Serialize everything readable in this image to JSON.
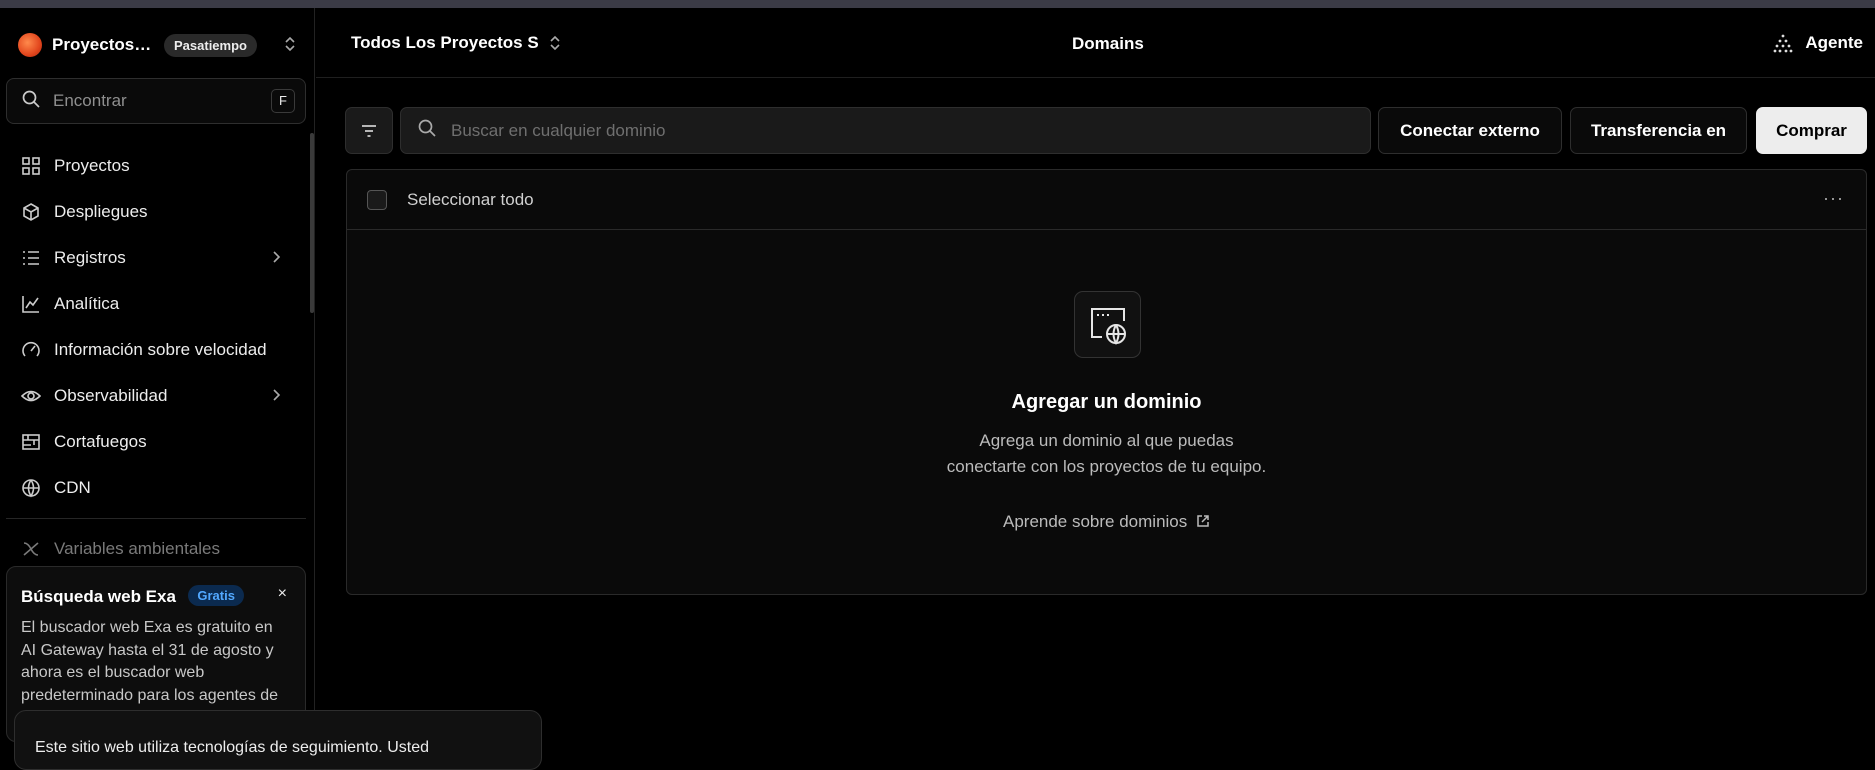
{
  "sidebar": {
    "team_name": "Proyectos ...",
    "plan_badge": "Pasatiempo",
    "search_placeholder": "Encontrar",
    "search_shortcut": "F",
    "items": [
      {
        "label": "Proyectos",
        "icon": "grid-icon"
      },
      {
        "label": "Despliegues",
        "icon": "cube-icon"
      },
      {
        "label": "Registros",
        "icon": "list-icon"
      },
      {
        "label": "Analítica",
        "icon": "chart-line-icon"
      },
      {
        "label": "Información sobre velocidad",
        "icon": "gauge-icon"
      },
      {
        "label": "Observabilidad",
        "icon": "eye-icon"
      },
      {
        "label": "Cortafuegos",
        "icon": "firewall-icon"
      },
      {
        "label": "CDN",
        "icon": "globe-icon"
      },
      {
        "label": "Variables ambientales",
        "icon": "variable-icon"
      }
    ]
  },
  "promo": {
    "title": "Búsqueda web Exa",
    "badge": "Gratis",
    "close": "×",
    "body": "El buscador web Exa es gratuito en AI Gateway hasta el 31 de agosto y ahora es el buscador web predeterminado para los agentes de"
  },
  "cookie_banner": {
    "text": "Este sitio web utiliza tecnologías de seguimiento. Usted"
  },
  "header": {
    "scope": "Todos Los Proyectos S",
    "title": "Domains",
    "agent": "Agente"
  },
  "toolbar": {
    "search_placeholder": "Buscar en cualquier dominio",
    "connect_external": "Conectar externo",
    "transfer_in": "Transferencia en",
    "buy": "Comprar"
  },
  "panel": {
    "select_all": "Seleccionar todo",
    "more": "···",
    "empty_title": "Agregar un dominio",
    "empty_desc_line1": "Agrega un dominio al que puedas",
    "empty_desc_line2": "conectarte con los proyectos de tu equipo.",
    "learn_link": "Aprende sobre dominios"
  }
}
